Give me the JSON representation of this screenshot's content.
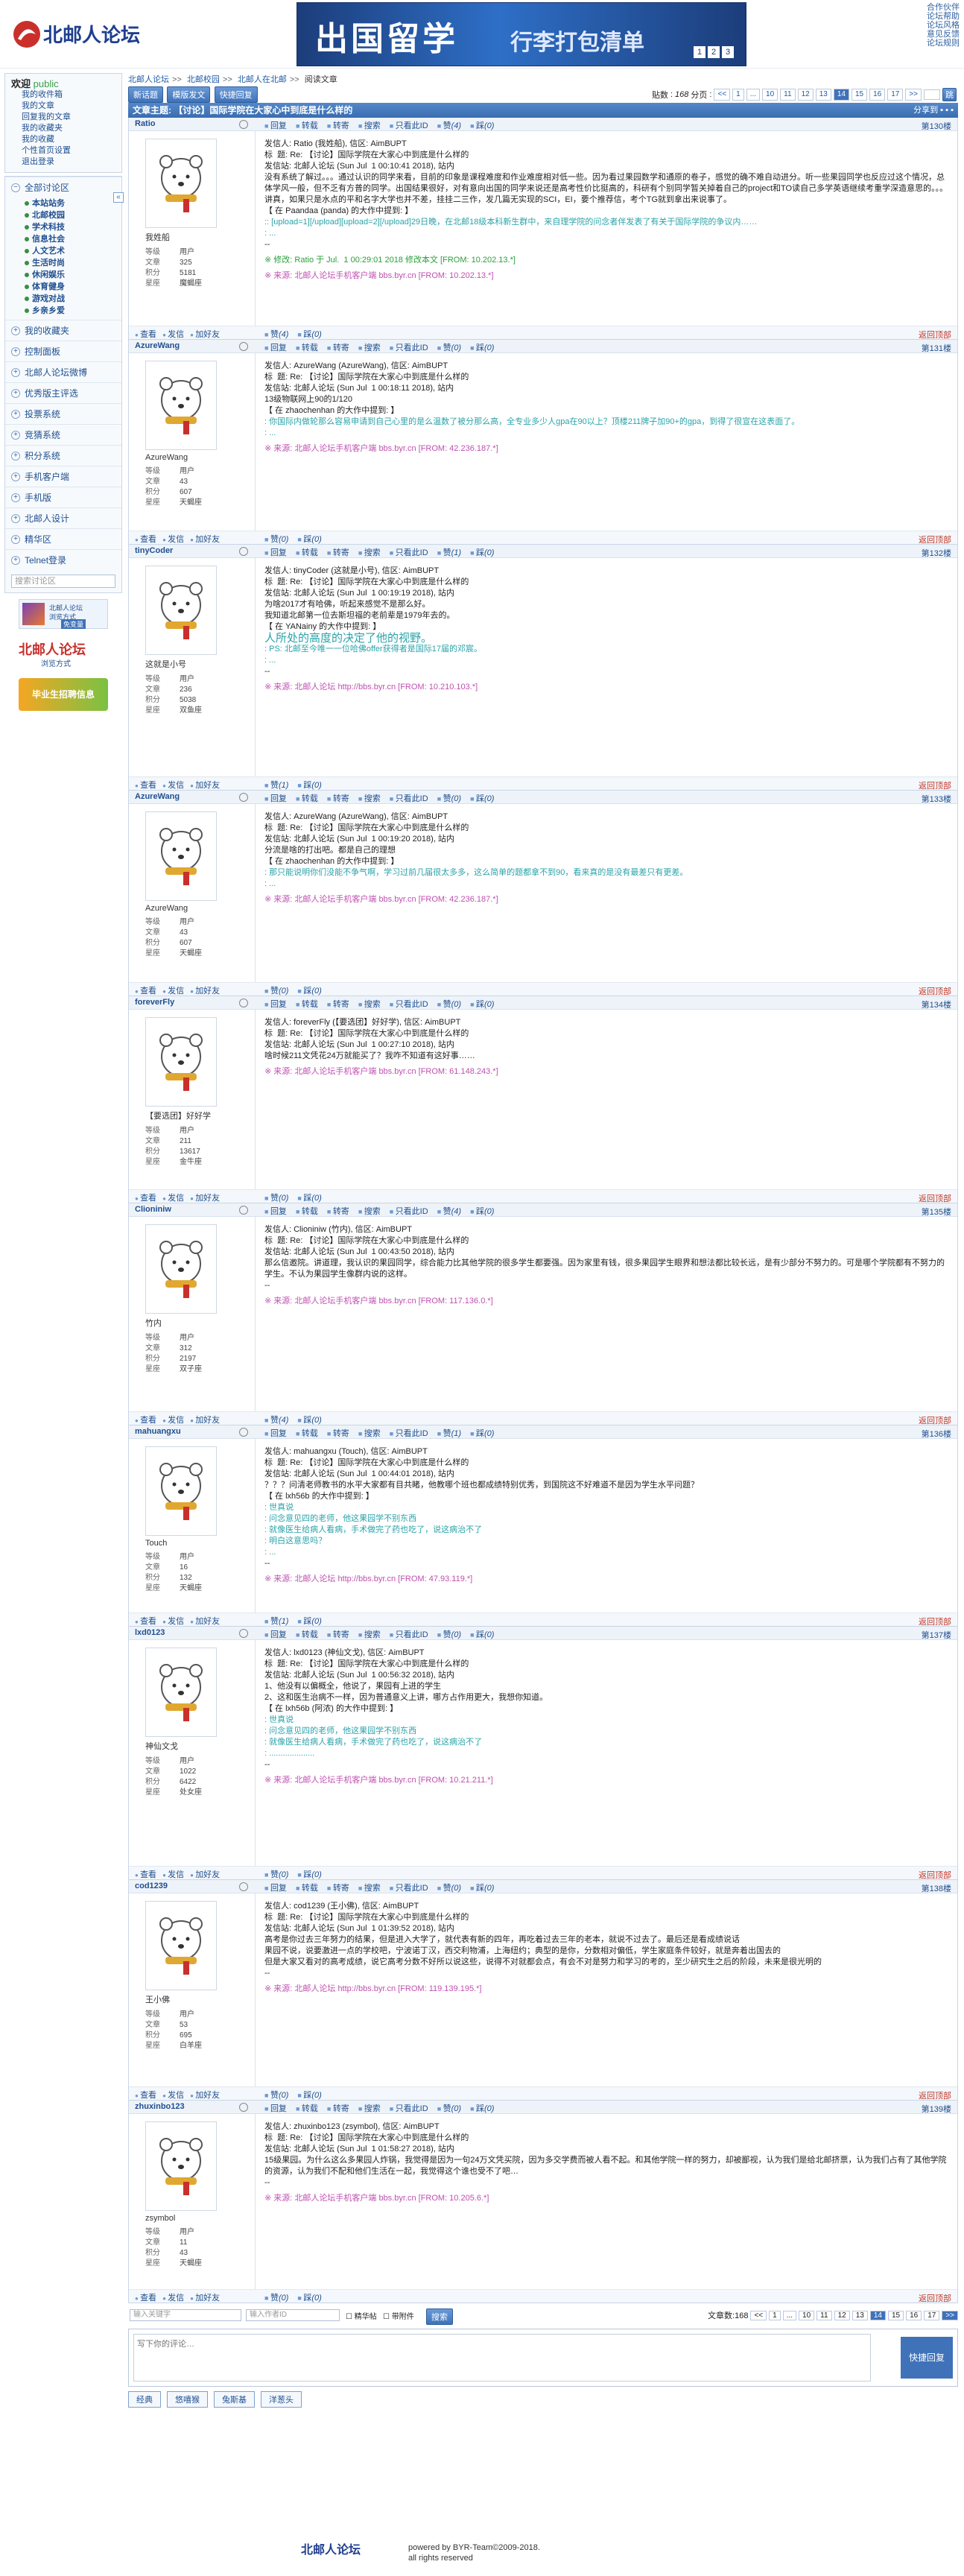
{
  "top": {
    "links": [
      "合作伙伴",
      "论坛帮助",
      "论坛风格",
      "意见反馈",
      "论坛规则"
    ],
    "banner": "出国留学",
    "banner_sub": "行李打包清单",
    "banner_dots": [
      "1",
      "2",
      "3"
    ]
  },
  "user": {
    "greeting": "欢迎",
    "id": "public",
    "items": [
      "我的收件箱",
      "我的文章",
      "回复我的文章",
      "我的收藏夹",
      "我的收藏",
      "个性首页设置",
      "退出登录"
    ]
  },
  "nav": {
    "all": "全部讨论区",
    "sections": [
      "本站站务",
      "北邮校园",
      "学术科技",
      "信息社会",
      "人文艺术",
      "生活时尚",
      "休闲娱乐",
      "体育健身",
      "游戏对战",
      "乡亲乡爱"
    ],
    "more": [
      "我的收藏夹",
      "控制面板",
      "北邮人论坛微博",
      "优秀版主评选",
      "投票系统",
      "竞猜系统",
      "积分系统",
      "手机客户端",
      "手机版",
      "北邮人设计",
      "精华区",
      "Telnet登录"
    ],
    "search": "搜索讨论区",
    "ad1": "北邮人论坛",
    "ad1b": "浏览方式",
    "ad1c": "免变量",
    "ad2": "北邮人论坛",
    "ad2b": "浏览方式",
    "ad3": "毕业生招聘信息"
  },
  "crumb": [
    "北邮人论坛",
    "北邮校园",
    "北邮人在北邮",
    "阅读文章"
  ],
  "bar": {
    "btns": [
      "新话题",
      "模版发文",
      "快捷回复"
    ],
    "count_label": "贴数",
    "count": "168",
    "pages_label": "分页",
    "pages": [
      "<<",
      "1",
      "...",
      "10",
      "11",
      "12",
      "13",
      "14",
      "15",
      "16",
      "17",
      ">>"
    ],
    "go": "跳"
  },
  "thread": {
    "title": "文章主题: 【讨论】国际学院在大家心中到底是什么样的",
    "share": "分享到"
  },
  "posts": [
    {
      "name": "Ratio",
      "nick": "我姓船",
      "floor": "第130楼",
      "level": "用户",
      "count": "325",
      "score": "5181",
      "star": "魔蝎座",
      "lines": [
        "发信人: Ratio (我姓船), 信区: AimBUPT",
        "标  题: Re: 【讨论】国际学院在大家心中到底是什么样的",
        "发信站: 北邮人论坛 (Sun Jul  1 00:10:41 2018), 站内",
        "",
        "没有系统了解过。。。通过认识的同学来看，目前的印象是课程难度和作业难度相对低一些。因为看过果园数学和通原的卷子，感觉的确不难自动进分。听一些果园同学也反应过这个情况，总体学风一般，但不乏有方普的同学。出国结果很好，对有意向出国的同学来说还是高考性价比挺高的，科研有个别同学暂关掉着自己的project和TO读自己多学英语继续考重学深造意思的。。。讲真，如果只是水点的平和名字大学也并不差，挂挂二三作，发几篇无实现的SCI，EI，要个推荐信，考个TG就到拿出来说事了。",
        "【 在 Paandaa (panda) 的大作中提到: 】",
        "",
        ":: [upload=1][/upload][upload=2][/upload]29日晚，在北邮18级本科新生群中，来自理学院的问念者伴发表了有关于国际学院的争议内……",
        ": ...",
        "",
        "--"
      ],
      "edit": "※ 修改: Ratio 于 Jul.  1 00:29:01 2018 修改本文 [FROM: 10.202.13.*]",
      "src": "※ 来源: 北邮人论坛手机客户端 bbs.byr.cn [FROM: 10.202.13.*]"
    },
    {
      "name": "AzureWang",
      "nick": "AzureWang",
      "floor": "第131楼",
      "level": "用户",
      "count": "43",
      "score": "607",
      "star": "天蝎座",
      "lines": [
        "发信人: AzureWang (AzureWang), 信区: AimBUPT",
        "标  题: Re: 【讨论】国际学院在大家心中到底是什么样的",
        "发信站: 北邮人论坛 (Sun Jul  1 00:18:11 2018), 站内",
        "",
        "13级物联网上90的1/120",
        "【 在 zhaochenhan 的大作中提到: 】",
        ": 你国际内做轮那么容易申请到自己心里的是么温数了被分那么高，全专业多少人gpa在90以上？顶楼211牌子加90+的gpa，到得了很宣在这表面了。",
        ": ..."
      ],
      "src": "※ 来源: 北邮人论坛手机客户端 bbs.byr.cn [FROM: 42.236.187.*]"
    },
    {
      "name": "tinyCoder",
      "nick": "这就是小号",
      "floor": "第132楼",
      "level": "用户",
      "count": "236",
      "score": "5038",
      "star": "双鱼座",
      "lines": [
        "发信人: tinyCoder (这就是小号), 信区: AimBUPT",
        "标  题: Re: 【讨论】国际学院在大家心中到底是什么样的",
        "发信站: 北邮人论坛 (Sun Jul  1 00:19:19 2018), 站内",
        "",
        "为啥2017才有哈佛，听起来感觉不是那么好。",
        "我知道北邮第一位去斯坦福的老前辈是1979年去的。",
        "",
        "【 在 YANainy 的大作中提到: 】",
        "人所处的高度的决定了他的视野。",
        ": PS: 北邮至今唯一一位哈佛offer获得者是国际17届的邓宸。",
        ": ...",
        "",
        "--"
      ],
      "src": "※ 来源: 北邮人论坛 http://bbs.byr.cn [FROM: 10.210.103.*]"
    },
    {
      "name": "AzureWang",
      "nick": "AzureWang",
      "floor": "第133楼",
      "level": "用户",
      "count": "43",
      "score": "607",
      "star": "天蝎座",
      "lines": [
        "发信人: AzureWang (AzureWang), 信区: AimBUPT",
        "标  题: Re: 【讨论】国际学院在大家心中到底是什么样的",
        "发信站: 北邮人论坛 (Sun Jul  1 00:19:20 2018), 站内",
        "",
        "分流是啥的打出吧。都是自己的理想",
        "【 在 zhaochenhan 的大作中提到: 】",
        ": 那只能说明你们没能不争气啊，学习过前几届很太多多，这么简单的题都拿不到90，看来真的是没有最差只有更差。",
        ": ..."
      ],
      "src": "※ 来源: 北邮人论坛手机客户端 bbs.byr.cn [FROM: 42.236.187.*]"
    },
    {
      "name": "foreverFly",
      "nick": "【要选团】好好学",
      "floor": "第134楼",
      "level": "用户",
      "count": "211",
      "score": "13617",
      "star": "金牛座",
      "lines": [
        "发信人: foreverFly (【要选团】好好学), 信区: AimBUPT",
        "标  题: Re: 【讨论】国际学院在大家心中到底是什么样的",
        "发信站: 北邮人论坛 (Sun Jul  1 00:27:10 2018), 站内",
        "",
        "啥时候211文凭花24万就能买了？我咋不知道有这好事……",
        ""
      ],
      "src": "※ 来源: 北邮人论坛手机客户端 bbs.byr.cn [FROM: 61.148.243.*]"
    },
    {
      "name": "Clioniniw",
      "nick": "竹内",
      "floor": "第135楼",
      "level": "用户",
      "count": "312",
      "score": "2197",
      "star": "双子座",
      "lines": [
        "发信人: Clioniniw (竹内), 信区: AimBUPT",
        "标  题: Re: 【讨论】国际学院在大家心中到底是什么样的",
        "发信站: 北邮人论坛 (Sun Jul  1 00:43:50 2018), 站内",
        "",
        "那么信邀院。讲道理，我认识的果园同学，综合能力比其他学院的很多学生都要强。因为家里有钱，很多果园学生眼界和想法都比较长远，是有少部分不努力的。可是哪个学院都有不努力的学生。不认为果园学生像群内说的这样。",
        "",
        "--"
      ],
      "src": "※ 来源: 北邮人论坛手机客户端 bbs.byr.cn [FROM: 117.136.0.*]"
    },
    {
      "name": "mahuangxu",
      "nick": "Touch",
      "floor": "第136楼",
      "level": "用户",
      "count": "16",
      "score": "132",
      "star": "天蝎座",
      "lines": [
        "发信人: mahuangxu (Touch), 信区: AimBUPT",
        "标  题: Re: 【讨论】国际学院在大家心中到底是什么样的",
        "发信站: 北邮人论坛 (Sun Jul  1 00:44:01 2018), 站内",
        "",
        "？？？问清老师教书的水平大家都有目共睹，他教哪个班也都成绩特别优秀，到国院这不好难道不是因为学生水平问题？",
        "【 在 lxh56b 的大作中提到: 】",
        ": 世真说",
        ": 问念意见四的老师，他这果园学不别东西",
        ": 就像医生给病人看病，手术做完了药也吃了，说这病治不了",
        ": 明白这意思吗？",
        ": ...",
        "",
        "--"
      ],
      "src": "※ 来源: 北邮人论坛 http://bbs.byr.cn [FROM: 47.93.119.*]"
    },
    {
      "name": "lxd0123",
      "nick": "神仙文戈",
      "floor": "第137楼",
      "level": "用户",
      "count": "1022",
      "score": "6422",
      "star": "处女座",
      "lines": [
        "发信人: lxd0123 (神仙文戈), 信区: AimBUPT",
        "标  题: Re: 【讨论】国际学院在大家心中到底是什么样的",
        "发信站: 北邮人论坛 (Sun Jul  1 00:56:32 2018), 站内",
        "",
        "1、他没有以偏概全，他说了，果园有上进的学生",
        "2、这和医生治病不一样，因为普通意义上讲，哪方占作用更大，我想你知道。",
        "",
        "【 在 lxh56b (阿浓) 的大作中提到: 】",
        ": 世真说",
        ": 问念意见四的老师，他这果园学不别东西",
        ": 就像医生给病人看病，手术做完了药也吃了，说这病治不了",
        ": ....................",
        "",
        "--"
      ],
      "src": "※ 来源: 北邮人论坛手机客户端 bbs.byr.cn [FROM: 10.21.211.*]"
    },
    {
      "name": "cod1239",
      "nick": "王小佛",
      "floor": "第138楼",
      "level": "用户",
      "count": "53",
      "score": "695",
      "star": "白羊座",
      "lines": [
        "发信人: cod1239 (王小佛), 信区: AimBUPT",
        "标  题: Re: 【讨论】国际学院在大家心中到底是什么样的",
        "发信站: 北邮人论坛 (Sun Jul  1 01:39:52 2018), 站内",
        "",
        "高考是你过去三年努力的结果，但是进入大学了，就代表有新的四年，再吃着过去三年的老本，就说不过去了。最后还是看成绩说话",
        "果园不说，说要激进一点的学校吧，宁波诺丁汉，西交利物浦，上海纽约；典型的是你，分数相对偏低，学生家庭条件较好，就是奔着出国去的",
        "但是大家又看对的高考成绩，说它高考分数不好所以说这些，说得不对就都会点，有会不对是努力和学习的考的，至少研究生之后的阶段，未来是很光明的",
        "",
        "--"
      ],
      "src": "※ 来源: 北邮人论坛 http://bbs.byr.cn [FROM: 119.139.195.*]"
    },
    {
      "name": "zhuxinbo123",
      "nick": "zsymbol",
      "floor": "第139楼",
      "level": "用户",
      "count": "11",
      "score": "43",
      "star": "天蝎座",
      "lines": [
        "发信人: zhuxinbo123 (zsymbol), 信区: AimBUPT",
        "标  题: Re: 【讨论】国际学院在大家心中到底是什么样的",
        "发信站: 北邮人论坛 (Sun Jul  1 01:58:27 2018), 站内",
        "",
        "15级果园。为什么这么多果园人炸锅，我觉得是因为一句24万文凭买院，因为多交学费而被人看不起。和其他学院一样的努力，却被鄙视，认为我们是给北邮挤票，认为我们占有了其他学院的资源，认为我们不配和他们生活在一起，我觉得这个谁也受不了吧…",
        "",
        "--"
      ],
      "src": "※ 来源: 北邮人论坛手机客户端 bbs.byr.cn [FROM: 10.205.6.*]"
    }
  ],
  "post_ui": {
    "actions": [
      "回复",
      "转载",
      "转寄",
      "搜索",
      "只看此ID",
      "赞",
      "踩"
    ],
    "zan_counts": [
      "(4)",
      "(0)",
      "(1)",
      "(0)",
      "(0)",
      "(4)",
      "(1)",
      "(0)",
      "(0)",
      "(0)"
    ],
    "cai_counts": [
      "(0)",
      "(0)",
      "(0)",
      "(0)",
      "(0)",
      "(0)",
      "(0)",
      "(0)",
      "(0)",
      "(0)"
    ],
    "labels": {
      "level": "等级",
      "count": "文章",
      "score": "积分",
      "star": "星座"
    },
    "foot": [
      "查看",
      "发信",
      "加好友"
    ],
    "foot_mid": [
      "赞",
      "踩"
    ],
    "top": "返回顶部"
  },
  "bottom": {
    "kw": "输入关键字",
    "author": "输入作者ID",
    "opt1": "精华帖",
    "opt2": "带附件",
    "search": "搜索",
    "count": "文章数:168",
    "pages": [
      "<<",
      "1",
      "...",
      "10",
      "11",
      "12",
      "13",
      "14",
      "15",
      "16",
      "17",
      ">>"
    ]
  },
  "reply": {
    "placeholder": "写下你的评论…",
    "send": "快捷回复"
  },
  "tabs": [
    "经典",
    "悠嘻猴",
    "兔斯基",
    "洋葱头"
  ],
  "footer": {
    "logo": "北邮人论坛",
    "line1": "powered by BYR-Team©2009-2018.",
    "line2": "all rights reserved"
  }
}
